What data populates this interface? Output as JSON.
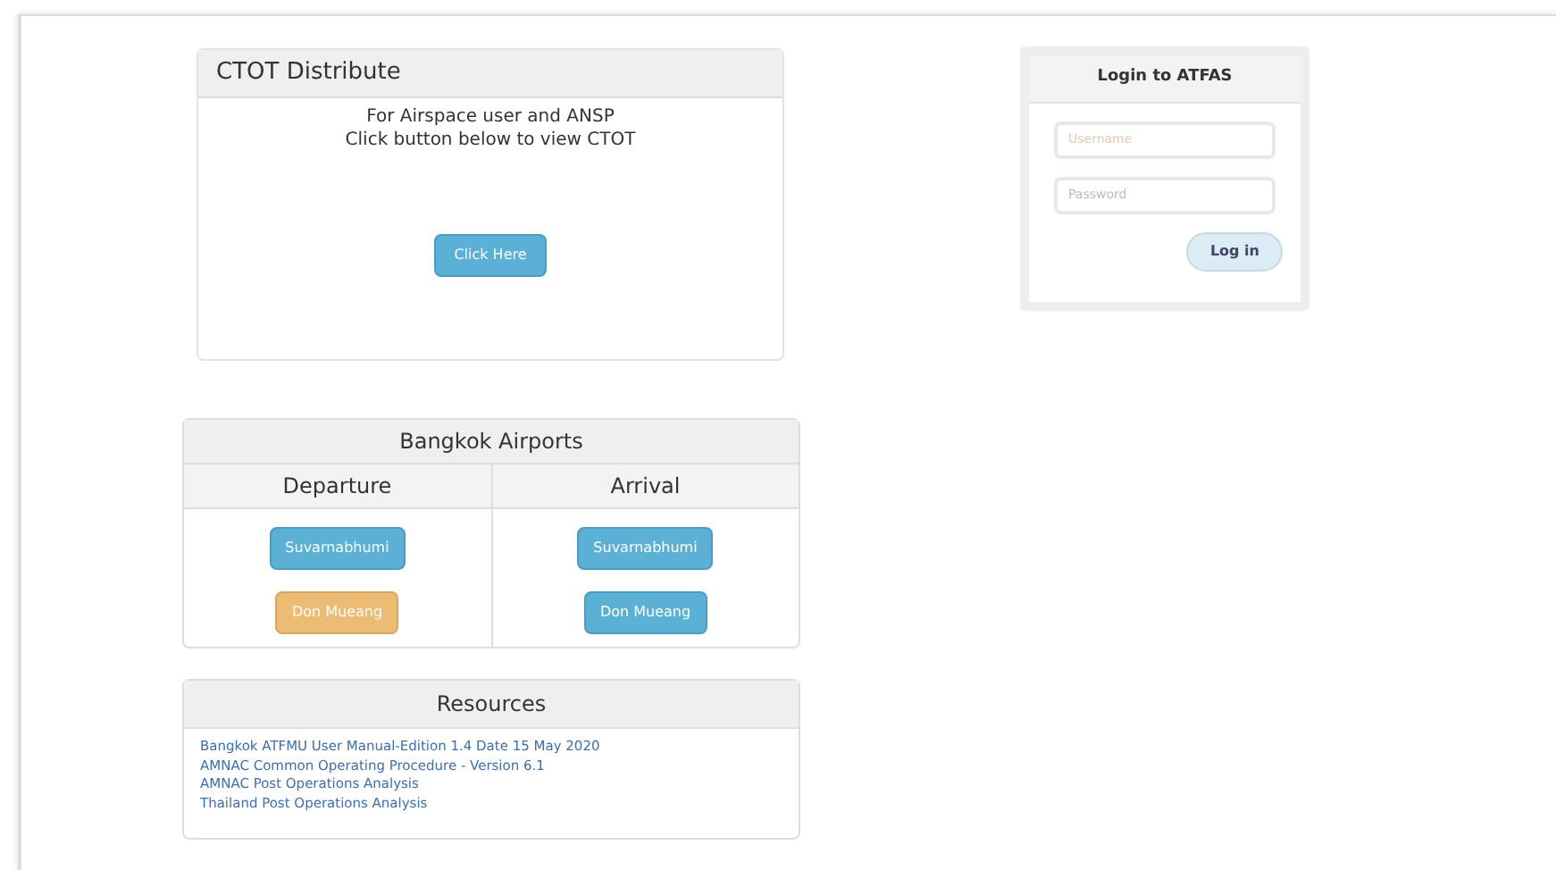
{
  "ctot": {
    "title": "CTOT Distribute",
    "lines": [
      "For Airspace user and ANSP",
      "Click button below to view CTOT"
    ],
    "button": "Click Here"
  },
  "airports": {
    "title": "Bangkok Airports",
    "columns": [
      {
        "title": "Departure",
        "buttons": [
          {
            "label": "Suvarnabhumi",
            "kind": "info"
          },
          {
            "label": "Don Mueang",
            "kind": "warning"
          }
        ]
      },
      {
        "title": "Arrival",
        "buttons": [
          {
            "label": "Suvarnabhumi",
            "kind": "info"
          },
          {
            "label": "Don Mueang",
            "kind": "info"
          }
        ]
      }
    ]
  },
  "resources": {
    "title": "Resources",
    "links": [
      "Bangkok ATFMU User Manual-Edition 1.4 Date 15 May 2020",
      "AMNAC Common Operating Procedure - Version 6.1",
      "AMNAC Post Operations Analysis",
      "Thailand Post Operations Analysis"
    ]
  },
  "login": {
    "title": "Login to ATFAS",
    "username": {
      "placeholder": "Username"
    },
    "password": {
      "placeholder": "Password"
    },
    "button": "Log in"
  }
}
